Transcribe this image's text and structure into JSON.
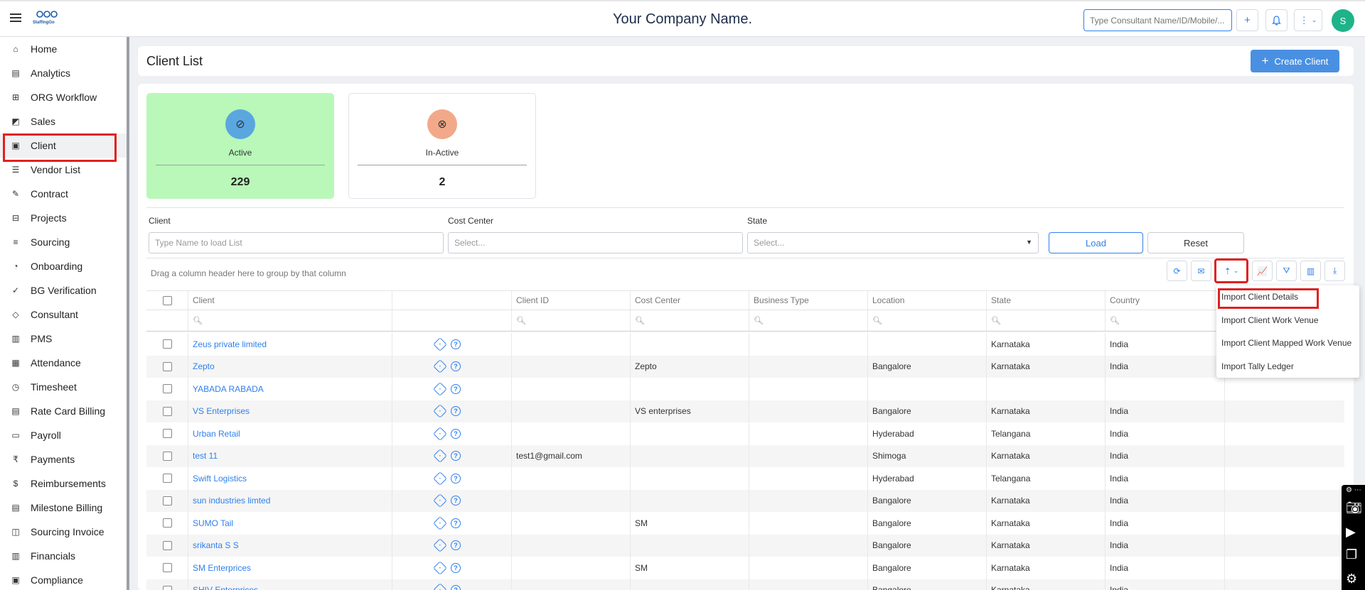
{
  "topbar": {
    "logo_text": "StaffingGo",
    "company_name": "Your Company Name.",
    "search_placeholder": "Type Consultant Name/ID/Mobile/...",
    "add_label": "+",
    "avatar_initial": "S"
  },
  "sidebar": {
    "items": [
      {
        "label": "Home",
        "icon": "home-icon"
      },
      {
        "label": "Analytics",
        "icon": "analytics-icon"
      },
      {
        "label": "ORG Workflow",
        "icon": "workflow-icon"
      },
      {
        "label": "Sales",
        "icon": "sales-icon"
      },
      {
        "label": "Client",
        "icon": "client-icon"
      },
      {
        "label": "Vendor List",
        "icon": "vendor-list-icon"
      },
      {
        "label": "Contract",
        "icon": "contract-icon"
      },
      {
        "label": "Projects",
        "icon": "projects-icon"
      },
      {
        "label": "Sourcing",
        "icon": "sourcing-icon"
      },
      {
        "label": "Onboarding",
        "icon": "onboarding-icon"
      },
      {
        "label": "BG Verification",
        "icon": "bg-verification-icon"
      },
      {
        "label": "Consultant",
        "icon": "consultant-icon"
      },
      {
        "label": "PMS",
        "icon": "pms-icon"
      },
      {
        "label": "Attendance",
        "icon": "attendance-icon"
      },
      {
        "label": "Timesheet",
        "icon": "timesheet-icon"
      },
      {
        "label": "Rate Card Billing",
        "icon": "rate-card-icon"
      },
      {
        "label": "Payroll",
        "icon": "payroll-icon"
      },
      {
        "label": "Payments",
        "icon": "rupee-icon"
      },
      {
        "label": "Reimbursements",
        "icon": "reimbursements-icon"
      },
      {
        "label": "Milestone Billing",
        "icon": "milestone-icon"
      },
      {
        "label": "Sourcing Invoice",
        "icon": "invoice-icon"
      },
      {
        "label": "Financials",
        "icon": "financials-icon"
      },
      {
        "label": "Compliance",
        "icon": "compliance-icon"
      }
    ]
  },
  "page": {
    "title": "Client List",
    "create_label": "Create Client"
  },
  "stats": {
    "active_label": "Active",
    "active_count": "229",
    "inactive_label": "In-Active",
    "inactive_count": "2"
  },
  "filters": {
    "client_label": "Client",
    "client_placeholder": "Type Name to load List",
    "cost_center_label": "Cost Center",
    "cost_center_placeholder": "Select...",
    "state_label": "State",
    "state_placeholder": "Select...",
    "load_label": "Load",
    "reset_label": "Reset"
  },
  "grid": {
    "group_hint": "Drag a column header here to group by that column",
    "columns": [
      "Client",
      "",
      "Client ID",
      "Cost Center",
      "Business Type",
      "Location",
      "State",
      "Country",
      ""
    ],
    "rows": [
      {
        "client": "Zeus private limited",
        "client_id": "",
        "cost_center": "",
        "business_type": "",
        "location": "",
        "state": "Karnataka",
        "country": "India"
      },
      {
        "client": "Zepto",
        "client_id": "",
        "cost_center": "Zepto",
        "business_type": "",
        "location": "Bangalore",
        "state": "Karnataka",
        "country": "India"
      },
      {
        "client": "YABADA RABADA",
        "client_id": "",
        "cost_center": "",
        "business_type": "",
        "location": "",
        "state": "",
        "country": ""
      },
      {
        "client": "VS Enterprises",
        "client_id": "",
        "cost_center": "VS enterprises",
        "business_type": "",
        "location": "Bangalore",
        "state": "Karnataka",
        "country": "India"
      },
      {
        "client": "Urban Retail",
        "client_id": "",
        "cost_center": "",
        "business_type": "",
        "location": "Hyderabad",
        "state": "Telangana",
        "country": "India"
      },
      {
        "client": "test 11",
        "client_id": "test1@gmail.com",
        "cost_center": "",
        "business_type": "",
        "location": "Shimoga",
        "state": "Karnataka",
        "country": "India"
      },
      {
        "client": "Swift Logistics",
        "client_id": "",
        "cost_center": "",
        "business_type": "",
        "location": "Hyderabad",
        "state": "Telangana",
        "country": "India"
      },
      {
        "client": "sun industries limted",
        "client_id": "",
        "cost_center": "",
        "business_type": "",
        "location": "Bangalore",
        "state": "Karnataka",
        "country": "India"
      },
      {
        "client": "SUMO Tail",
        "client_id": "",
        "cost_center": "SM",
        "business_type": "",
        "location": "Bangalore",
        "state": "Karnataka",
        "country": "India"
      },
      {
        "client": "srikanta S S",
        "client_id": "",
        "cost_center": "",
        "business_type": "",
        "location": "Bangalore",
        "state": "Karnataka",
        "country": "India"
      },
      {
        "client": "SM Enterprices",
        "client_id": "",
        "cost_center": "SM",
        "business_type": "",
        "location": "Bangalore",
        "state": "Karnataka",
        "country": "India"
      },
      {
        "client": "SHIV Enterprices",
        "client_id": "",
        "cost_center": "",
        "business_type": "",
        "location": "Bangalore",
        "state": "Karnataka",
        "country": "India"
      }
    ]
  },
  "import_menu": {
    "items": [
      "Import Client Details",
      "Import Client Work Venue",
      "Import Client Mapped Work Venue",
      "Import Tally Ledger"
    ]
  }
}
